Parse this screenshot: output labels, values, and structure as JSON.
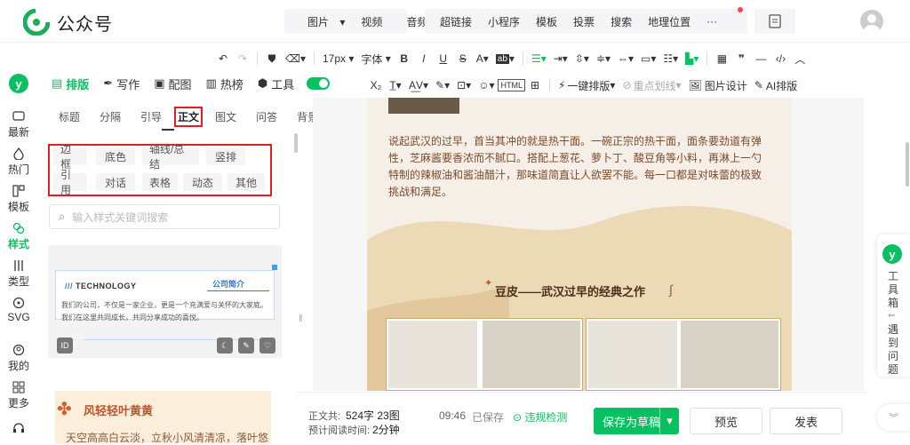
{
  "app": {
    "title": "公众号"
  },
  "topbar": {
    "group1": [
      "图片",
      "视频",
      "音频"
    ],
    "group2": [
      "超链接",
      "小程序",
      "模板",
      "投票",
      "搜索",
      "地理位置",
      "···"
    ]
  },
  "toolbar": {
    "font_size": "17px",
    "font_family": "字体",
    "tool_oneclick": "一键排版",
    "tool_highlight": "重点划线",
    "tool_image_design": "图片设计",
    "tool_ai": "AI排版"
  },
  "leftnav": {
    "items": [
      {
        "label": "最新",
        "icon": "chat-icon"
      },
      {
        "label": "热门",
        "icon": "fire-icon"
      },
      {
        "label": "模板",
        "icon": "template-icon"
      },
      {
        "label": "样式",
        "icon": "style-icon"
      },
      {
        "label": "类型",
        "icon": "type-icon"
      },
      {
        "label": "SVG",
        "icon": "svg-icon"
      },
      {
        "label": "我的",
        "icon": "user-icon"
      },
      {
        "label": "更多",
        "icon": "grid-icon"
      }
    ]
  },
  "maintabs": [
    {
      "label": "排版"
    },
    {
      "label": "写作"
    },
    {
      "label": "配图"
    },
    {
      "label": "热榜"
    },
    {
      "label": "工具"
    }
  ],
  "subtabs": [
    "标题",
    "分隔",
    "引导",
    "正文",
    "图文",
    "问答",
    "背景"
  ],
  "chips": [
    "边框",
    "底色",
    "轴线/总结",
    "竖排",
    "引用",
    "对话",
    "表格",
    "动态",
    "其他"
  ],
  "search": {
    "placeholder": "输入样式关键词搜索"
  },
  "card1": {
    "brand": "TECHNOLOGY",
    "tag": "公司简介",
    "body": "我们的公司，不仅是一家企业，更是一个充满爱与关怀的大家庭。我们在这里共同成长，共同分享成功的喜悦。",
    "id_label": "ID"
  },
  "card2": {
    "title": "风轻轻叶黄黄",
    "body": "天空高高白云淡，立秋小风清清凉，落叶悠"
  },
  "article": {
    "paragraph": "说起武汉的过早，首当其冲的就是热干面。一碗正宗的热干面，面条要劲道有弹性，芝麻酱要香浓而不腻口。搭配上葱花、萝卜丁、酸豆角等小料，再淋上一勺特制的辣椒油和酱油醋汁，那味道简直让人欲罢不能。每一口都是对味蕾的极致挑战和满足。",
    "subtitle": "豆皮——武汉过早的经典之作"
  },
  "footer": {
    "wordcount_label": "正文共:",
    "wordcount_value": "524字 23图",
    "readtime_label": "预计阅读时间:",
    "readtime_value": "2分钟",
    "saved_time": "09:46",
    "saved_label": "已保存",
    "violation": "违规检测",
    "save_draft": "保存为草稿",
    "preview": "预览",
    "publish": "发表"
  },
  "rightbar": {
    "toolbox": "工具箱",
    "feedback": "遇到问题"
  },
  "colors": {
    "brand": "#07c160",
    "highlight": "#e02020",
    "doc_bg": "#f5efe8"
  }
}
